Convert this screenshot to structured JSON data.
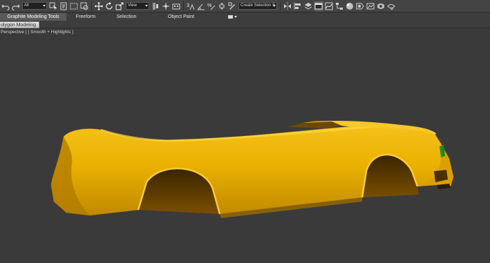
{
  "toolbar": {
    "selection_filter": "All",
    "reference_coord": "View",
    "named_selection": "Create Selection S",
    "icons": [
      "undo-icon",
      "redo-icon",
      "link-icon",
      "unlink-icon",
      "bind-spacewarp-icon",
      "select-object-icon",
      "select-by-name-icon",
      "rect-selection-icon",
      "window-crossing-icon",
      "move-icon",
      "rotate-icon",
      "scale-icon",
      "pivot-center-icon",
      "manipulate-icon",
      "keyboard-shortcut-icon",
      "snaps-3-icon",
      "angle-snap-icon",
      "percent-snap-icon",
      "spinner-snap-icon",
      "edit-named-selections-icon",
      "mirror-icon",
      "align-icon",
      "layer-manager-icon",
      "graphite-toggle-icon",
      "curve-editor-icon",
      "schematic-view-icon",
      "material-editor-icon",
      "render-setup-icon",
      "rendered-frame-icon",
      "render-production-icon",
      "render-iterative-icon"
    ]
  },
  "ribbon": {
    "tabs": [
      {
        "label": "Graphite Modeling Tools",
        "active": true
      },
      {
        "label": "Freeform",
        "active": false
      },
      {
        "label": "Selection",
        "active": false
      },
      {
        "label": "Object Paint",
        "active": false
      }
    ]
  },
  "panel": {
    "label": "olygon Modeling"
  },
  "viewport": {
    "label": "Perspective ] [ Smooth + Highlights ]"
  },
  "colors": {
    "toolbar_bg": "#444444",
    "ribbon_bg": "#3d3d3d",
    "viewport_bg": "#3a3a3a",
    "car_body": "#f0b800",
    "car_shadow": "#a87600",
    "wheel_well": "#5c3a00",
    "headlight_green": "#1e8a1e"
  }
}
